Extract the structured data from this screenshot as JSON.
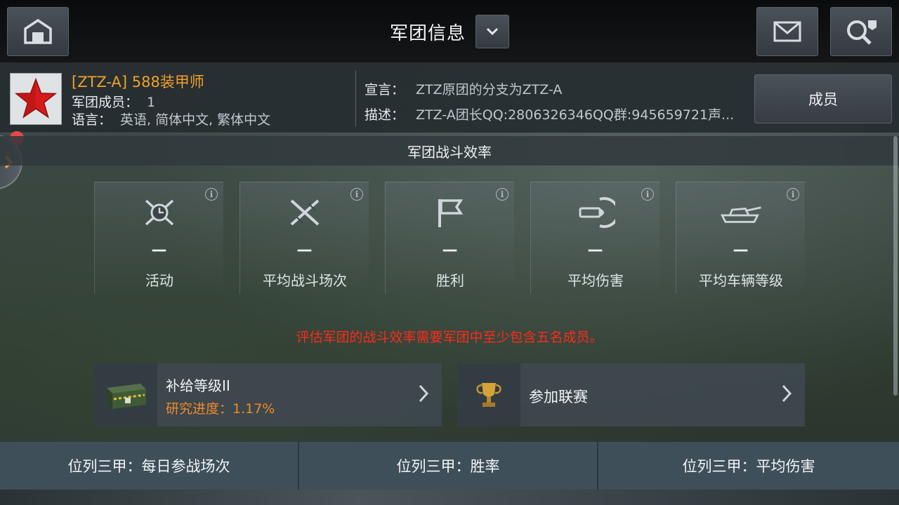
{
  "header": {
    "title": "军团信息"
  },
  "clan": {
    "name": "[ZTZ-A] 588装甲师",
    "members_label": "军团成员：",
    "members_value": "1",
    "language_label": "语言：",
    "language_value": "英语, 简体中文, 繁体中文",
    "motto_label": "宣言：",
    "motto_value": "ZTZ原团的分支为ZTZ-A",
    "description_label": "描述：",
    "description_value": "ZTZ-A团长QQ:2806326346QQ群:945659721声...",
    "members_button": "成员"
  },
  "efficiency": {
    "section_title": "军团战斗效率",
    "stats": [
      {
        "label": "活动",
        "value": "—",
        "icon": "activity-icon"
      },
      {
        "label": "平均战斗场次",
        "value": "—",
        "icon": "battles-icon"
      },
      {
        "label": "胜利",
        "value": "—",
        "icon": "victory-flag-icon"
      },
      {
        "label": "平均伤害",
        "value": "—",
        "icon": "damage-shell-icon"
      },
      {
        "label": "平均车辆等级",
        "value": "—",
        "icon": "tank-tier-icon"
      }
    ],
    "warning": "评估军团的战斗效率需要军团中至少包含五名成员。"
  },
  "supply": {
    "title": "补给等级II",
    "progress": "研究进度：1.17%"
  },
  "league": {
    "title": "参加联赛"
  },
  "bottom_tabs": [
    "位列三甲：每日参战场次",
    "位列三甲：胜率",
    "位列三甲：平均伤害"
  ],
  "colors": {
    "clan_name": "#f0a12a",
    "warning": "#ff2a1a",
    "progress": "#f08a2c",
    "notification_dot": "#e64848"
  }
}
